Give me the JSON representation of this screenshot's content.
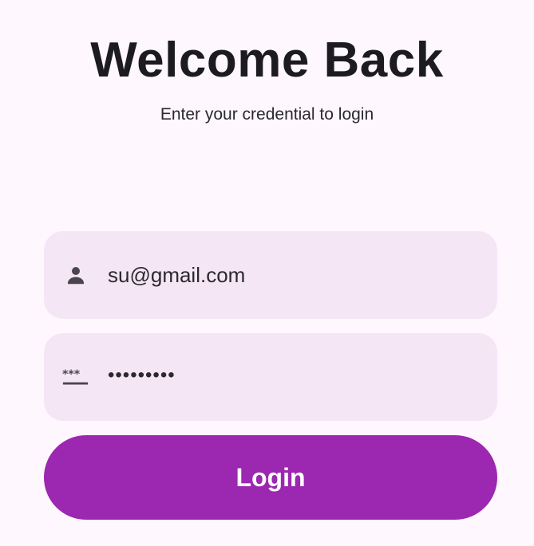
{
  "header": {
    "title": "Welcome Back",
    "subtitle": "Enter your credential to login"
  },
  "form": {
    "email": {
      "icon": "person-icon",
      "value": "su@gmail.com"
    },
    "password": {
      "icon": "password-icon",
      "value": "*********"
    },
    "login_label": "Login"
  },
  "colors": {
    "background": "#fef7fd",
    "field": "#f5e6f6",
    "accent": "#9c27b0",
    "text": "#1c1b1f"
  }
}
